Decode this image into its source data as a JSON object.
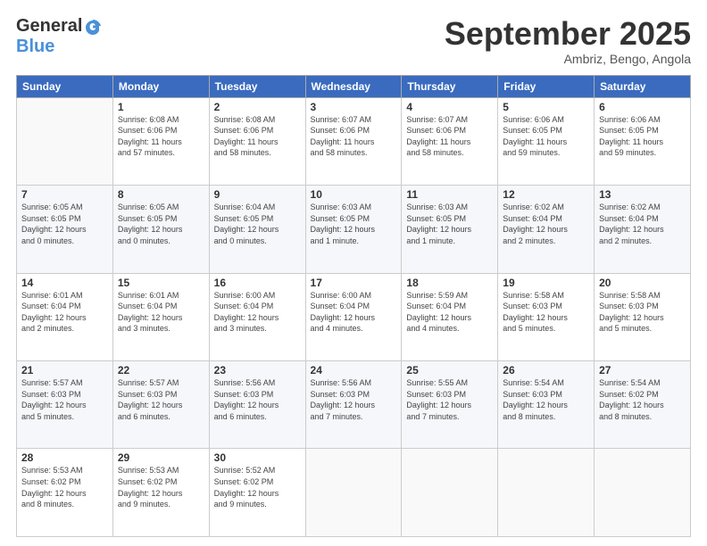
{
  "header": {
    "logo_general": "General",
    "logo_blue": "Blue",
    "month_title": "September 2025",
    "location": "Ambriz, Bengo, Angola"
  },
  "days_of_week": [
    "Sunday",
    "Monday",
    "Tuesday",
    "Wednesday",
    "Thursday",
    "Friday",
    "Saturday"
  ],
  "weeks": [
    [
      {
        "day": "",
        "info": ""
      },
      {
        "day": "1",
        "info": "Sunrise: 6:08 AM\nSunset: 6:06 PM\nDaylight: 11 hours\nand 57 minutes."
      },
      {
        "day": "2",
        "info": "Sunrise: 6:08 AM\nSunset: 6:06 PM\nDaylight: 11 hours\nand 58 minutes."
      },
      {
        "day": "3",
        "info": "Sunrise: 6:07 AM\nSunset: 6:06 PM\nDaylight: 11 hours\nand 58 minutes."
      },
      {
        "day": "4",
        "info": "Sunrise: 6:07 AM\nSunset: 6:06 PM\nDaylight: 11 hours\nand 58 minutes."
      },
      {
        "day": "5",
        "info": "Sunrise: 6:06 AM\nSunset: 6:05 PM\nDaylight: 11 hours\nand 59 minutes."
      },
      {
        "day": "6",
        "info": "Sunrise: 6:06 AM\nSunset: 6:05 PM\nDaylight: 11 hours\nand 59 minutes."
      }
    ],
    [
      {
        "day": "7",
        "info": "Sunrise: 6:05 AM\nSunset: 6:05 PM\nDaylight: 12 hours\nand 0 minutes."
      },
      {
        "day": "8",
        "info": "Sunrise: 6:05 AM\nSunset: 6:05 PM\nDaylight: 12 hours\nand 0 minutes."
      },
      {
        "day": "9",
        "info": "Sunrise: 6:04 AM\nSunset: 6:05 PM\nDaylight: 12 hours\nand 0 minutes."
      },
      {
        "day": "10",
        "info": "Sunrise: 6:03 AM\nSunset: 6:05 PM\nDaylight: 12 hours\nand 1 minute."
      },
      {
        "day": "11",
        "info": "Sunrise: 6:03 AM\nSunset: 6:05 PM\nDaylight: 12 hours\nand 1 minute."
      },
      {
        "day": "12",
        "info": "Sunrise: 6:02 AM\nSunset: 6:04 PM\nDaylight: 12 hours\nand 2 minutes."
      },
      {
        "day": "13",
        "info": "Sunrise: 6:02 AM\nSunset: 6:04 PM\nDaylight: 12 hours\nand 2 minutes."
      }
    ],
    [
      {
        "day": "14",
        "info": "Sunrise: 6:01 AM\nSunset: 6:04 PM\nDaylight: 12 hours\nand 2 minutes."
      },
      {
        "day": "15",
        "info": "Sunrise: 6:01 AM\nSunset: 6:04 PM\nDaylight: 12 hours\nand 3 minutes."
      },
      {
        "day": "16",
        "info": "Sunrise: 6:00 AM\nSunset: 6:04 PM\nDaylight: 12 hours\nand 3 minutes."
      },
      {
        "day": "17",
        "info": "Sunrise: 6:00 AM\nSunset: 6:04 PM\nDaylight: 12 hours\nand 4 minutes."
      },
      {
        "day": "18",
        "info": "Sunrise: 5:59 AM\nSunset: 6:04 PM\nDaylight: 12 hours\nand 4 minutes."
      },
      {
        "day": "19",
        "info": "Sunrise: 5:58 AM\nSunset: 6:03 PM\nDaylight: 12 hours\nand 5 minutes."
      },
      {
        "day": "20",
        "info": "Sunrise: 5:58 AM\nSunset: 6:03 PM\nDaylight: 12 hours\nand 5 minutes."
      }
    ],
    [
      {
        "day": "21",
        "info": "Sunrise: 5:57 AM\nSunset: 6:03 PM\nDaylight: 12 hours\nand 5 minutes."
      },
      {
        "day": "22",
        "info": "Sunrise: 5:57 AM\nSunset: 6:03 PM\nDaylight: 12 hours\nand 6 minutes."
      },
      {
        "day": "23",
        "info": "Sunrise: 5:56 AM\nSunset: 6:03 PM\nDaylight: 12 hours\nand 6 minutes."
      },
      {
        "day": "24",
        "info": "Sunrise: 5:56 AM\nSunset: 6:03 PM\nDaylight: 12 hours\nand 7 minutes."
      },
      {
        "day": "25",
        "info": "Sunrise: 5:55 AM\nSunset: 6:03 PM\nDaylight: 12 hours\nand 7 minutes."
      },
      {
        "day": "26",
        "info": "Sunrise: 5:54 AM\nSunset: 6:03 PM\nDaylight: 12 hours\nand 8 minutes."
      },
      {
        "day": "27",
        "info": "Sunrise: 5:54 AM\nSunset: 6:02 PM\nDaylight: 12 hours\nand 8 minutes."
      }
    ],
    [
      {
        "day": "28",
        "info": "Sunrise: 5:53 AM\nSunset: 6:02 PM\nDaylight: 12 hours\nand 8 minutes."
      },
      {
        "day": "29",
        "info": "Sunrise: 5:53 AM\nSunset: 6:02 PM\nDaylight: 12 hours\nand 9 minutes."
      },
      {
        "day": "30",
        "info": "Sunrise: 5:52 AM\nSunset: 6:02 PM\nDaylight: 12 hours\nand 9 minutes."
      },
      {
        "day": "",
        "info": ""
      },
      {
        "day": "",
        "info": ""
      },
      {
        "day": "",
        "info": ""
      },
      {
        "day": "",
        "info": ""
      }
    ]
  ]
}
